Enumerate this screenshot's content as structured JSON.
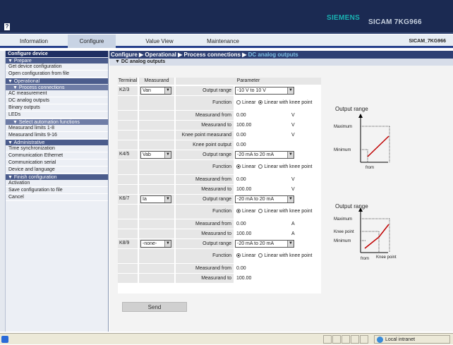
{
  "header": {
    "help_icon": "?",
    "brand": "SIEMENS",
    "product": "SICAM 7KG966"
  },
  "tabs": [
    {
      "label": "Information"
    },
    {
      "label": "Configure"
    },
    {
      "label": "Value View"
    },
    {
      "label": "Maintenance"
    }
  ],
  "device_name": "SICAM_7KG966",
  "sidebar": {
    "title": "Configure device",
    "groups": [
      {
        "label": "▼ Prepare",
        "items": [
          "Get device configuration",
          "Open configuration from file"
        ]
      },
      {
        "label": "▼ Operational",
        "sub": "▼ Process connections",
        "items": [
          "AC measurement",
          "DC analog outputs",
          "Binary outputs",
          "LEDs"
        ],
        "sub2": "▼ Select automation functions",
        "items2": [
          "Measurand limits 1-8",
          "Measurand limits 9-16"
        ]
      },
      {
        "label": "▼ Administrative",
        "items": [
          "Time synchronization",
          "Communication Ethernet",
          "Communication serial",
          "Device and language"
        ]
      },
      {
        "label": "▼ Finish configuration",
        "items": [
          "Activation",
          "Save configuration to file",
          "Cancel"
        ]
      }
    ]
  },
  "breadcrumb": {
    "p1": "Configure",
    "p2": "Operational",
    "p3": "Process connections",
    "p4": "DC analog outputs",
    "sep": "▶"
  },
  "section_title": "▼ DC analog outputs",
  "table": {
    "col_terminal": "Terminal",
    "col_measurand": "Measurand",
    "col_parameter": "Parameter",
    "lbl_output_range": "Output range",
    "lbl_function": "Function",
    "lbl_meas_from": "Measurand from",
    "lbl_meas_to": "Measurand to",
    "lbl_knee_meas": "Knee point measurand",
    "lbl_knee_out": "Knee point output",
    "opt_linear": "Linear",
    "opt_knee": "Linear with knee point",
    "rows": [
      {
        "terminal": "K2/3",
        "measurand": "Van",
        "range": "-10 V to 10 V",
        "func": "knee",
        "from": "0.00",
        "to": "100.00",
        "unit": "V",
        "knee_meas": "0.00",
        "knee_out": "0.00"
      },
      {
        "terminal": "K4/5",
        "measurand": "Vab",
        "range": "-20 mA to 20 mA",
        "func": "linear",
        "from": "0.00",
        "to": "100.00",
        "unit": "V"
      },
      {
        "terminal": "K6/7",
        "measurand": "Ia",
        "range": "-20 mA to 20 mA",
        "func": "linear",
        "from": "0.00",
        "to": "100.00",
        "unit": "A"
      },
      {
        "terminal": "K8/9",
        "measurand": "-none-",
        "range": "-20 mA to 20 mA",
        "func": "linear",
        "from": "0.00",
        "to": "100.00",
        "unit": ""
      }
    ]
  },
  "chart1": {
    "title": "Output range",
    "y_max": "Maximum",
    "y_min": "Minimum",
    "x_label": "from"
  },
  "chart2": {
    "title": "Output range",
    "y_max": "Maximum",
    "y_knee": "Knee point",
    "y_min": "Minimum",
    "x_from": "from",
    "x_knee": "Knee\npoint"
  },
  "send_label": "Send",
  "statusbar": {
    "zone": "Local intranet"
  },
  "colors": {
    "nav": "#1b2a52",
    "accent": "#25408c",
    "breadcrumb_last": "#7fc1e6",
    "chart_line": "#c00000"
  }
}
